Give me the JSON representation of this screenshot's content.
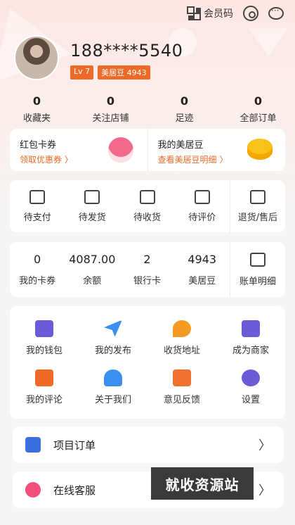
{
  "header": {
    "member_code_label": "会员码",
    "accent": "#ef6a26"
  },
  "profile": {
    "phone": "188****5540",
    "level_badge": "Lv 7",
    "beans_badge": "美居豆 4943"
  },
  "stats": [
    {
      "value": "0",
      "label": "收藏夹"
    },
    {
      "value": "0",
      "label": "关注店铺"
    },
    {
      "value": "0",
      "label": "足迹"
    },
    {
      "value": "0",
      "label": "全部订单"
    }
  ],
  "promo": {
    "left": {
      "title": "红包卡券",
      "link": "领取优惠券 〉"
    },
    "right": {
      "title": "我的美居豆",
      "link": "查看美居豆明细 〉"
    }
  },
  "orders": [
    {
      "label": "待支付",
      "icon": "wallet-icon"
    },
    {
      "label": "待发货",
      "icon": "box-out-icon"
    },
    {
      "label": "待收货",
      "icon": "package-icon"
    },
    {
      "label": "待评价",
      "icon": "comment-icon"
    },
    {
      "label": "退货/售后",
      "icon": "refund-icon"
    }
  ],
  "wallet": [
    {
      "value": "0",
      "label": "我的卡券"
    },
    {
      "value": "4087.00",
      "label": "余额"
    },
    {
      "value": "2",
      "label": "银行卡"
    },
    {
      "value": "4943",
      "label": "美居豆"
    },
    {
      "label": "账单明细"
    }
  ],
  "grid": [
    {
      "label": "我的钱包",
      "icon": "wallet-icon",
      "color": "#6b5bd6"
    },
    {
      "label": "我的发布",
      "icon": "paper-plane-icon",
      "color": "#3b8ff0"
    },
    {
      "label": "收货地址",
      "icon": "map-pin-icon",
      "color": "#f59a23"
    },
    {
      "label": "成为商家",
      "icon": "store-icon",
      "color": "#6b5bd6"
    },
    {
      "label": "我的评论",
      "icon": "comment-icon",
      "color": "#ef6a26"
    },
    {
      "label": "关于我们",
      "icon": "users-icon",
      "color": "#3b8ff0"
    },
    {
      "label": "意见反馈",
      "icon": "edit-icon",
      "color": "#f07030"
    },
    {
      "label": "设置",
      "icon": "gear-icon",
      "color": "#6b5bd6"
    }
  ],
  "rows": [
    {
      "label": "项目订单",
      "icon": "document-icon",
      "color": "#3b6fe0"
    },
    {
      "label": "在线客服",
      "icon": "smile-icon",
      "color": "#f0507a"
    }
  ],
  "watermark": "就收资源站"
}
